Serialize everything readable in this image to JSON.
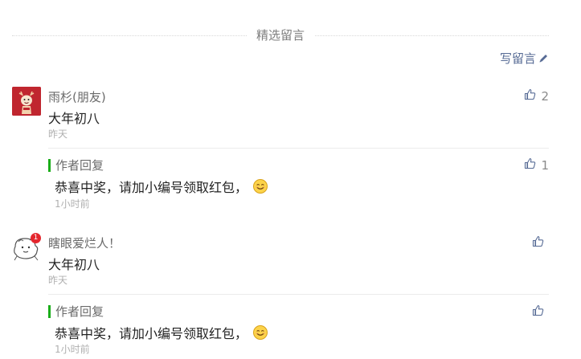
{
  "section_title": "精选留言",
  "write_comment_label": "写留言",
  "comments": [
    {
      "nickname": "雨杉(朋友)",
      "content": "大年初八",
      "time": "昨天",
      "likes": "2",
      "reply": {
        "author_label": "作者回复",
        "content": "恭喜中奖，请加小编号领取红包，",
        "time": "1小时前",
        "likes": "1"
      }
    },
    {
      "nickname": "瞎眼爱烂人！",
      "badge": "1",
      "content": "大年初八",
      "time": "昨天",
      "likes": "",
      "reply": {
        "author_label": "作者回复",
        "content": "恭喜中奖，请加小编号领取红包，",
        "time": "1小时前",
        "likes": ""
      }
    }
  ],
  "icons": {
    "pencil": "pencil-icon",
    "like": "thumb-up-icon",
    "emoji": "smile-emoji-icon"
  },
  "colors": {
    "link": "#576b95",
    "reply_bar": "#1aad19",
    "badge": "#e4262d"
  }
}
